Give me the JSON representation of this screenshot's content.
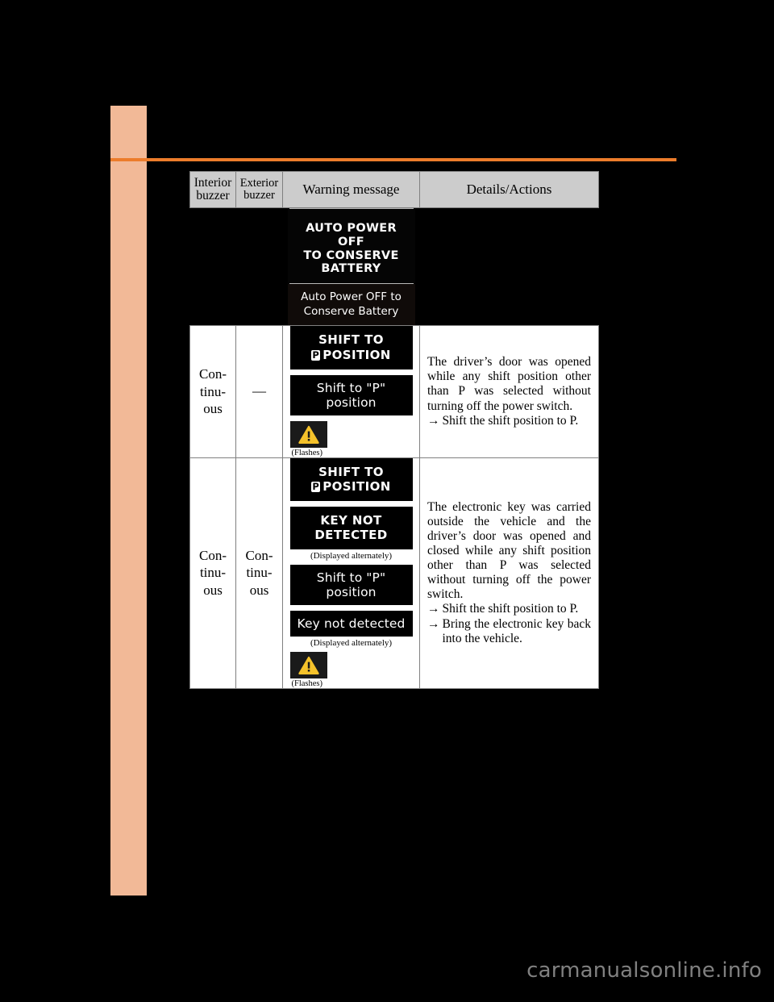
{
  "page": {
    "background_color": "#000000",
    "side_tab_color": "#f2b997",
    "rule_color": "#ec7c2b",
    "watermark": "carmanualsonline.info"
  },
  "table": {
    "headers": [
      {
        "label": "Interior buzzer",
        "line1": "Interior",
        "line2": "buzzer"
      },
      {
        "label": "Exterior buzzer",
        "line1": "Exterior",
        "line2": "buzzer"
      },
      {
        "label": "Warning message"
      },
      {
        "label": "Details/Actions"
      }
    ],
    "rows": [
      {
        "interior_buzzer": "",
        "exterior_buzzer": "",
        "displays": [
          {
            "style": "multiline-upper",
            "lines": [
              "AUTO POWER OFF",
              "TO CONSERVE",
              "BATTERY"
            ]
          },
          {
            "style": "multiline-lower",
            "lines": [
              "Auto Power OFF to",
              "Conserve Battery"
            ]
          }
        ],
        "details": []
      },
      {
        "interior_buzzer": "Con- tinu- ous",
        "interior_buzzer_lines": [
          "Con-",
          "tinu-",
          "ous"
        ],
        "exterior_buzzer": "—",
        "displays": [
          {
            "style": "box-2line",
            "line1": "SHIFT TO",
            "p_glyph": "P",
            "line2": "POSITION"
          },
          {
            "style": "box-1line",
            "text": "Shift to \"P\" position"
          },
          {
            "style": "warning-icon",
            "caption": "(Flashes)"
          }
        ],
        "details_paragraph": "The driver’s door was opened while any shift position other than P was selected without turning off the power switch.",
        "details_actions": [
          "Shift the shift position to P."
        ]
      },
      {
        "interior_buzzer_lines": [
          "Con-",
          "tinu-",
          "ous"
        ],
        "exterior_buzzer_lines": [
          "Con-",
          "tinu-",
          "ous"
        ],
        "displays": [
          {
            "style": "box-2line",
            "line1": "SHIFT TO",
            "p_glyph": "P",
            "line2": "POSITION"
          },
          {
            "style": "box-2line-plain",
            "line1": "KEY NOT",
            "line2": "DETECTED"
          },
          {
            "style": "caption",
            "text": "(Displayed alternately)"
          },
          {
            "style": "box-1line",
            "text": "Shift to \"P\" position"
          },
          {
            "style": "box-1line",
            "text": "Key not detected"
          },
          {
            "style": "caption",
            "text": "(Displayed alternately)"
          },
          {
            "style": "warning-icon",
            "caption": "(Flashes)"
          }
        ],
        "details_paragraph": "The electronic key was carried outside the vehicle and the driver’s door was opened and closed while any shift position other than P was selected without turning off the power switch.",
        "details_actions": [
          "Shift the shift position to P.",
          "Bring the electronic key back into the vehicle."
        ]
      }
    ]
  },
  "labels": {
    "arrow": "→",
    "flashes": "(Flashes)",
    "displayed_alternately": "(Displayed alternately)",
    "em_dash": "—"
  }
}
